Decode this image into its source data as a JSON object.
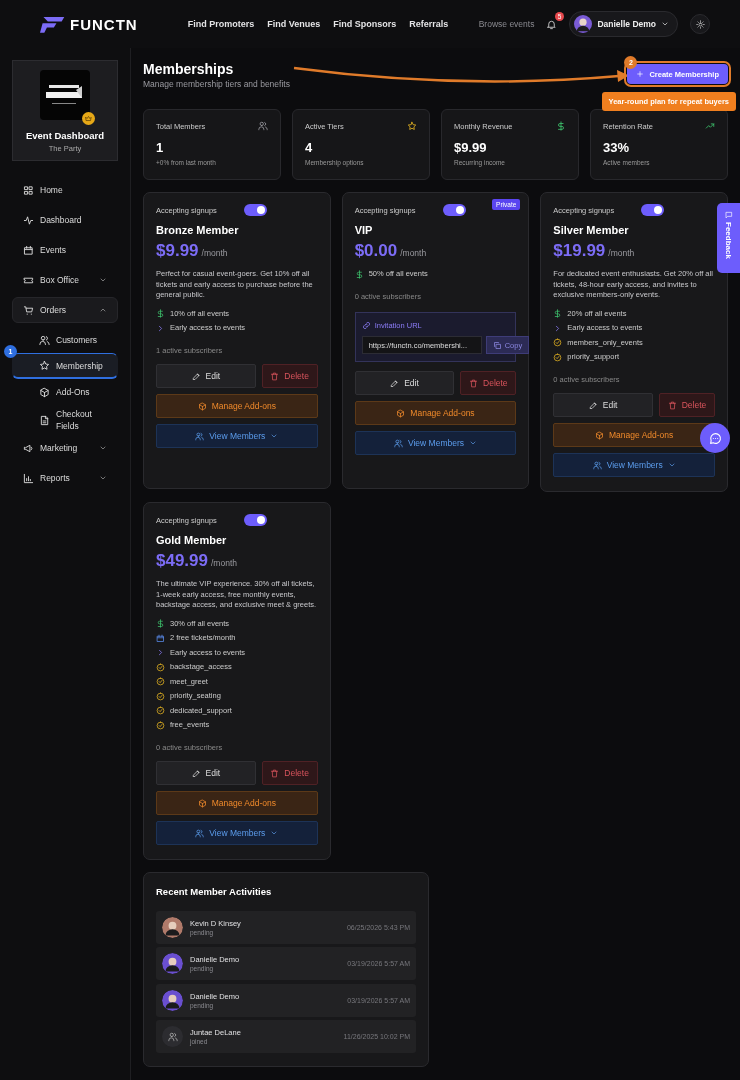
{
  "header": {
    "brand": "FUNCTN",
    "links": [
      "Find Promoters",
      "Find Venues",
      "Find Sponsors",
      "Referrals"
    ],
    "browse": "Browse events",
    "notifications": "5",
    "user": "Danielle Demo"
  },
  "sidebar": {
    "event": {
      "title": "Event Dashboard",
      "subtitle": "The Party"
    },
    "items": [
      {
        "label": "Home",
        "kind": "home",
        "selected": false
      },
      {
        "label": "Dashboard",
        "kind": "pulse",
        "selected": false
      },
      {
        "label": "Events",
        "kind": "calendar",
        "selected": false
      },
      {
        "label": "Box Office",
        "kind": "ticket",
        "selected": false,
        "expanded": false
      },
      {
        "label": "Orders",
        "kind": "cart",
        "selected": false,
        "expanded": true,
        "children": [
          {
            "label": "Customers",
            "kind": "users",
            "selected": false
          },
          {
            "label": "Membership",
            "kind": "star",
            "selected": true,
            "step": "1"
          },
          {
            "label": "Add-Ons",
            "kind": "box",
            "selected": false
          },
          {
            "label": "Checkout Fields",
            "kind": "file",
            "selected": false
          }
        ]
      },
      {
        "label": "Marketing",
        "kind": "megaphone",
        "selected": false,
        "expanded": false
      },
      {
        "label": "Reports",
        "kind": "chart",
        "selected": false,
        "expanded": false
      }
    ]
  },
  "page": {
    "title": "Memberships",
    "subtitle": "Manage membership tiers and benefits",
    "create_button": {
      "label": "Create Membership",
      "step": "2",
      "tooltip": "Year-round plan for repeat buyers"
    }
  },
  "stats": [
    {
      "label": "Total Members",
      "value": "1",
      "note": "+0% from last month",
      "kind": "users"
    },
    {
      "label": "Active Tiers",
      "value": "4",
      "note": "Membership options",
      "kind": "star"
    },
    {
      "label": "Monthly Revenue",
      "value": "$9.99",
      "note": "Recurring income",
      "kind": "dollar"
    },
    {
      "label": "Retention Rate",
      "value": "33%",
      "note": "Active members",
      "kind": "trend"
    }
  ],
  "tiers": [
    {
      "toggle_label": "Accepting signups",
      "accepting": true,
      "name": "Bronze Member",
      "price": "$9.99",
      "period": "/month",
      "description": "Perfect for casual event-goers. Get 10% off all tickets and early access to purchase before the general public.",
      "features": [
        {
          "kind": "discount",
          "text": "10% off all events"
        },
        {
          "kind": "access",
          "text": "Early access to events"
        }
      ],
      "subscribers": "1 active subscribers",
      "edit": "Edit",
      "delete": "Delete",
      "addons": "Manage Add-ons",
      "members": "View Members"
    },
    {
      "toggle_label": "Accepting signups",
      "accepting": true,
      "badge": "Private",
      "name": "VIP",
      "price": "$0.00",
      "period": "/month",
      "features": [
        {
          "kind": "discount",
          "text": "50% off all events"
        }
      ],
      "subscribers": "0 active subscribers",
      "invitation": {
        "label": "Invitation URL",
        "url": "https://functn.co/membershi...",
        "copy": "Copy"
      },
      "edit": "Edit",
      "delete": "Delete",
      "addons": "Manage Add-ons",
      "members": "View Members"
    },
    {
      "toggle_label": "Accepting signups",
      "accepting": true,
      "name": "Silver Member",
      "price": "$19.99",
      "period": "/month",
      "description": "For dedicated event enthusiasts. Get 20% off all tickets, 48-hour early access, and invites to exclusive members-only events.",
      "features": [
        {
          "kind": "discount",
          "text": "20% off all events"
        },
        {
          "kind": "access",
          "text": "Early access to events"
        },
        {
          "kind": "perk",
          "text": "members_only_events"
        },
        {
          "kind": "perk",
          "text": "priority_support"
        }
      ],
      "subscribers": "0 active subscribers",
      "edit": "Edit",
      "delete": "Delete",
      "addons": "Manage Add-ons",
      "members": "View Members"
    },
    {
      "toggle_label": "Accepting signups",
      "accepting": true,
      "name": "Gold Member",
      "price": "$49.99",
      "period": "/month",
      "description": "The ultimate VIP experience. 30% off all tickets, 1-week early access, free monthly events, backstage access, and exclusive meet & greets.",
      "features": [
        {
          "kind": "discount",
          "text": "30% off all events"
        },
        {
          "kind": "calendar",
          "text": "2 free tickets/month"
        },
        {
          "kind": "access",
          "text": "Early access to events"
        },
        {
          "kind": "perk",
          "text": "backstage_access"
        },
        {
          "kind": "perk",
          "text": "meet_greet"
        },
        {
          "kind": "perk",
          "text": "priority_seating"
        },
        {
          "kind": "perk",
          "text": "dedicated_support"
        },
        {
          "kind": "perk",
          "text": "free_events"
        }
      ],
      "subscribers": "0 active subscribers",
      "edit": "Edit",
      "delete": "Delete",
      "addons": "Manage Add-ons",
      "members": "View Members"
    }
  ],
  "activities": {
    "title": "Recent Member Activities",
    "items": [
      {
        "name": "Kevin D Kinsey",
        "status": "pending",
        "time": "06/25/2026 5:43 PM"
      },
      {
        "name": "Danielle Demo",
        "status": "pending",
        "time": "03/19/2026 5:57 AM"
      },
      {
        "name": "Danielle Demo",
        "status": "pending",
        "time": "03/19/2026 5:57 AM"
      },
      {
        "name": "Juntae DeLane",
        "status": "joined",
        "time": "11/26/2025 10:02 PM",
        "kind": "placeholder"
      }
    ]
  },
  "feedback": "Feedback"
}
